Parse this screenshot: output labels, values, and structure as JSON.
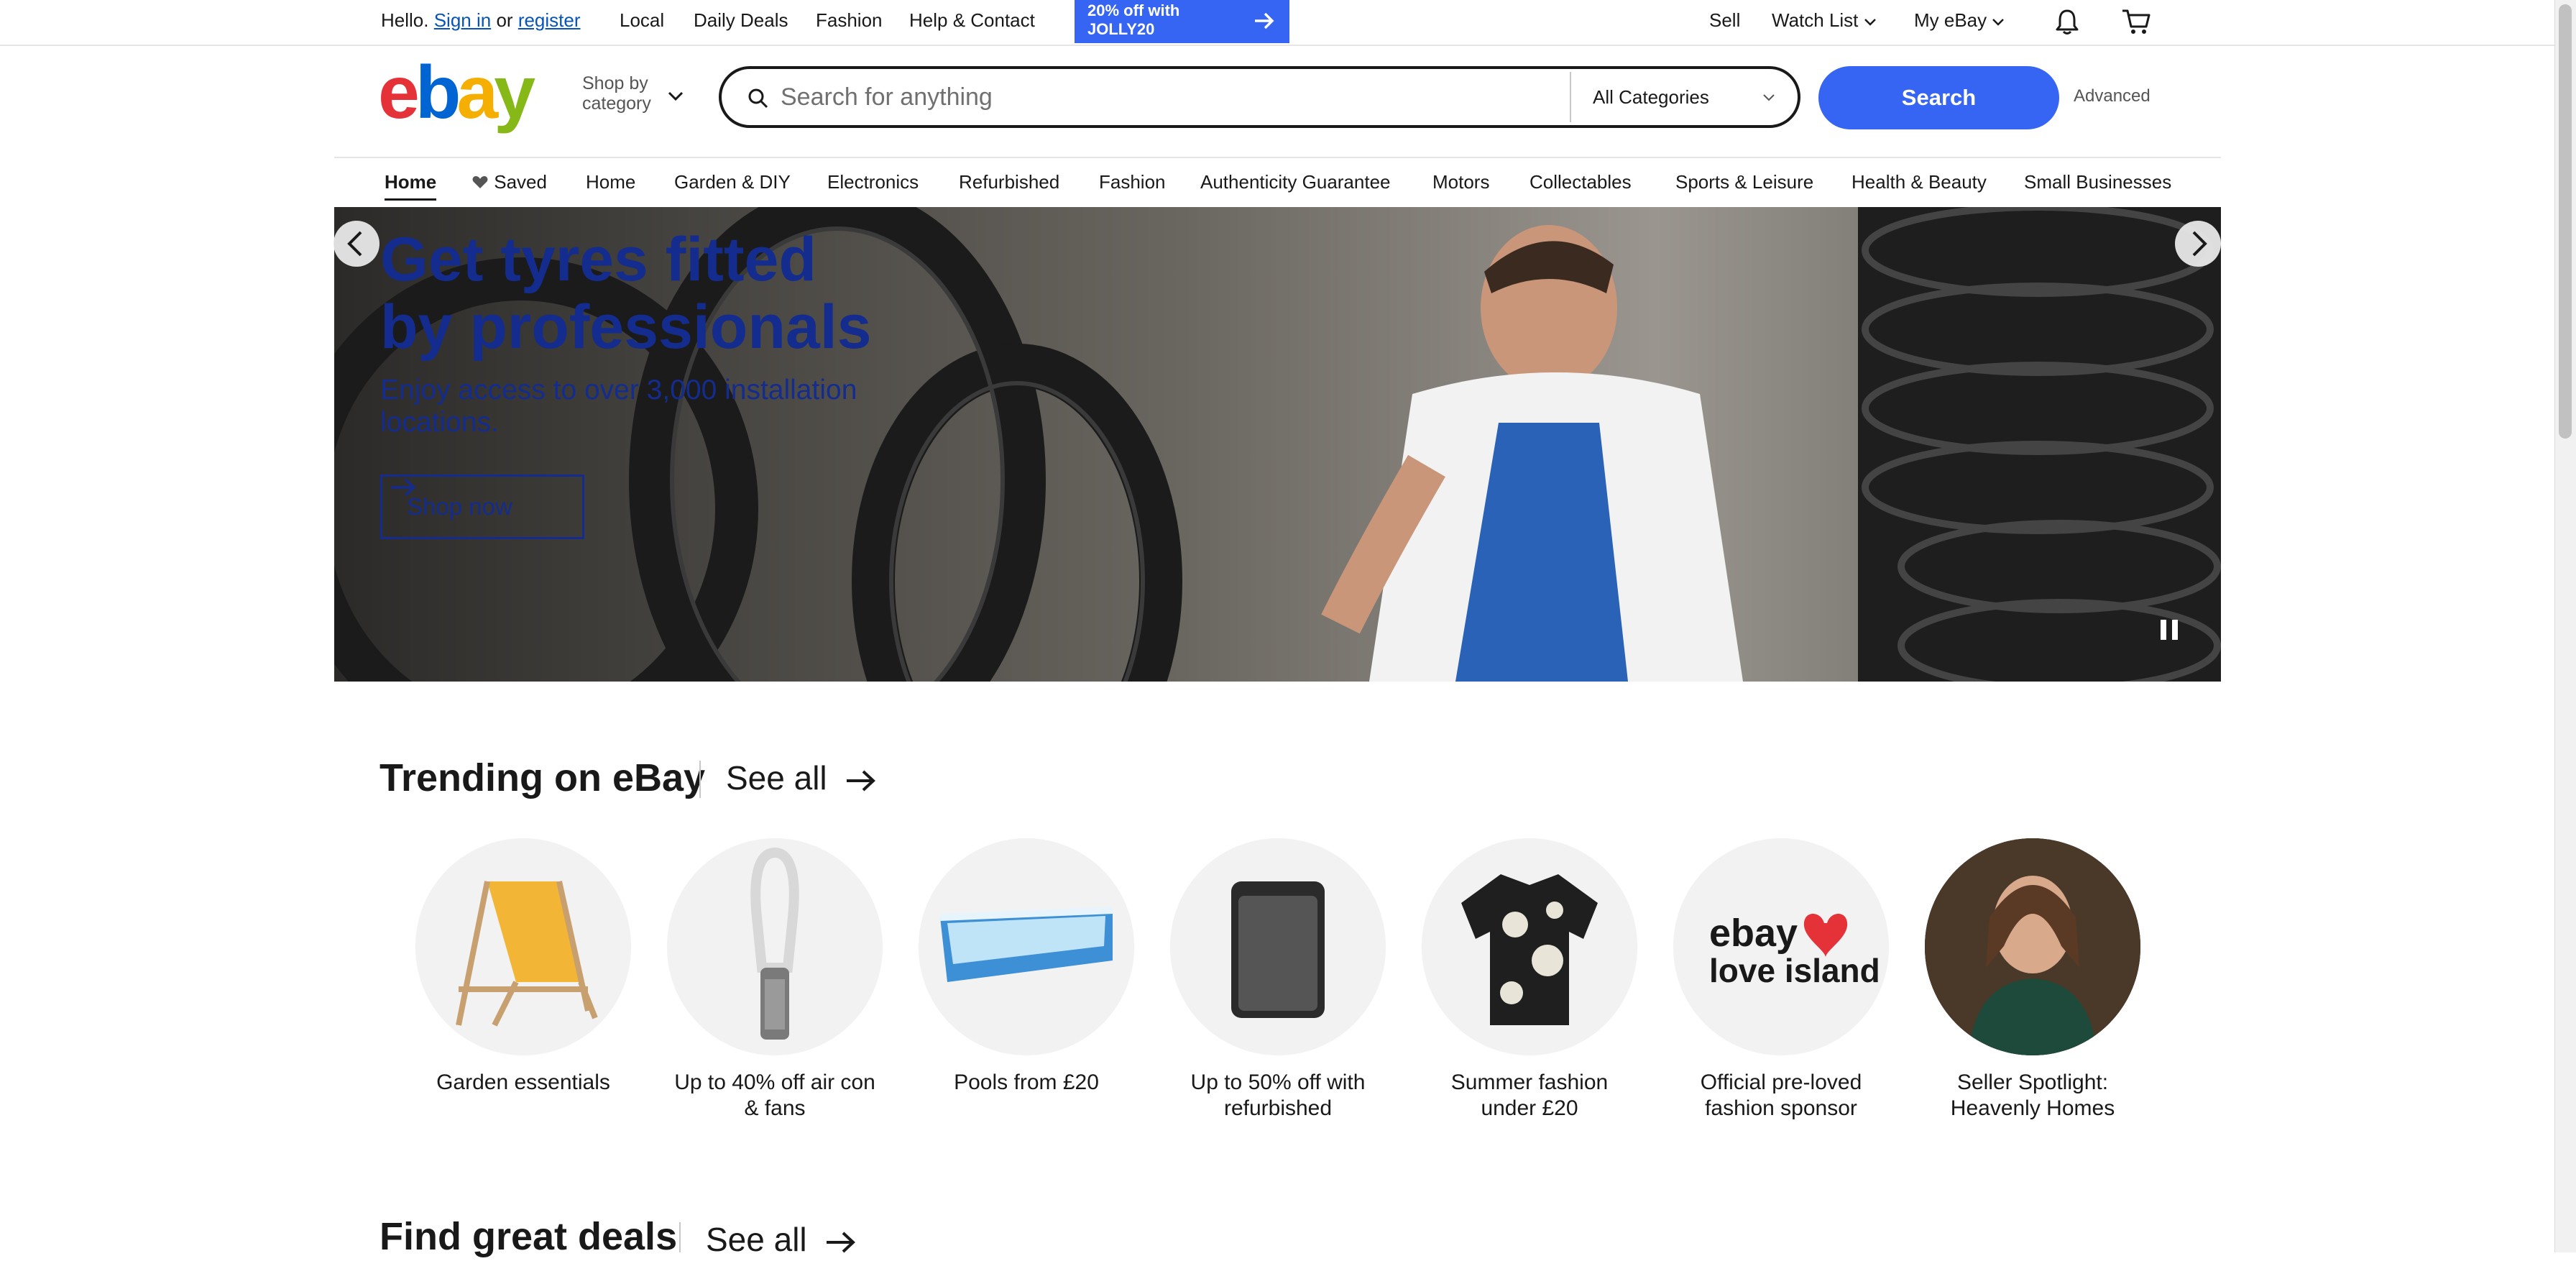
{
  "topbar": {
    "hello": "Hello.",
    "sign_in": "Sign in",
    "or": "or",
    "register": "register",
    "local": "Local",
    "daily_deals": "Daily Deals",
    "fashion": "Fashion",
    "help_contact": "Help & Contact",
    "promo_text": "20% off with JOLLY20",
    "sell": "Sell",
    "watch_list": "Watch List",
    "my_ebay": "My eBay"
  },
  "header": {
    "shop_by_category": "Shop by category",
    "search_placeholder": "Search for anything",
    "search_category": "All Categories",
    "search_button": "Search",
    "advanced": "Advanced"
  },
  "nav": {
    "items": [
      "Home",
      "Saved",
      "Home",
      "Garden & DIY",
      "Electronics",
      "Refurbished",
      "Fashion",
      "Authenticity Guarantee",
      "Motors",
      "Collectables",
      "Sports & Leisure",
      "Health & Beauty",
      "Small Businesses"
    ]
  },
  "banner": {
    "title": "Get tyres fitted by professionals",
    "subtitle": "Enjoy access to over 3,000 installation locations.",
    "cta": "Shop now"
  },
  "trending": {
    "title": "Trending on eBay",
    "see_all": "See all",
    "items": [
      {
        "label": "Garden essentials",
        "icon": "deck-chair-image"
      },
      {
        "label": "Up to 40% off air con & fans",
        "icon": "air-purifier-image"
      },
      {
        "label": "Pools from £20",
        "icon": "paddling-pool-image"
      },
      {
        "label": "Up to 50% off with refurbished",
        "icon": "speaker-image"
      },
      {
        "label": "Summer fashion under £20",
        "icon": "shirt-image"
      },
      {
        "label": "Official pre-loved fashion sponsor",
        "icon": "love-island-logo"
      },
      {
        "label": "Seller Spotlight: Heavenly Homes",
        "icon": "seller-portrait-image"
      }
    ]
  },
  "deals": {
    "title": "Find great deals",
    "see_all": "See all"
  },
  "logo_text": "ebay",
  "love_island_logo": {
    "line1": "ebay",
    "line2": "love island"
  },
  "colors": {
    "brand_blue": "#3665f3",
    "banner_text": "#132c8e",
    "ebay_red": "#e53238",
    "ebay_blue": "#0064d2",
    "ebay_yellow": "#f5af02",
    "ebay_green": "#86b817"
  }
}
